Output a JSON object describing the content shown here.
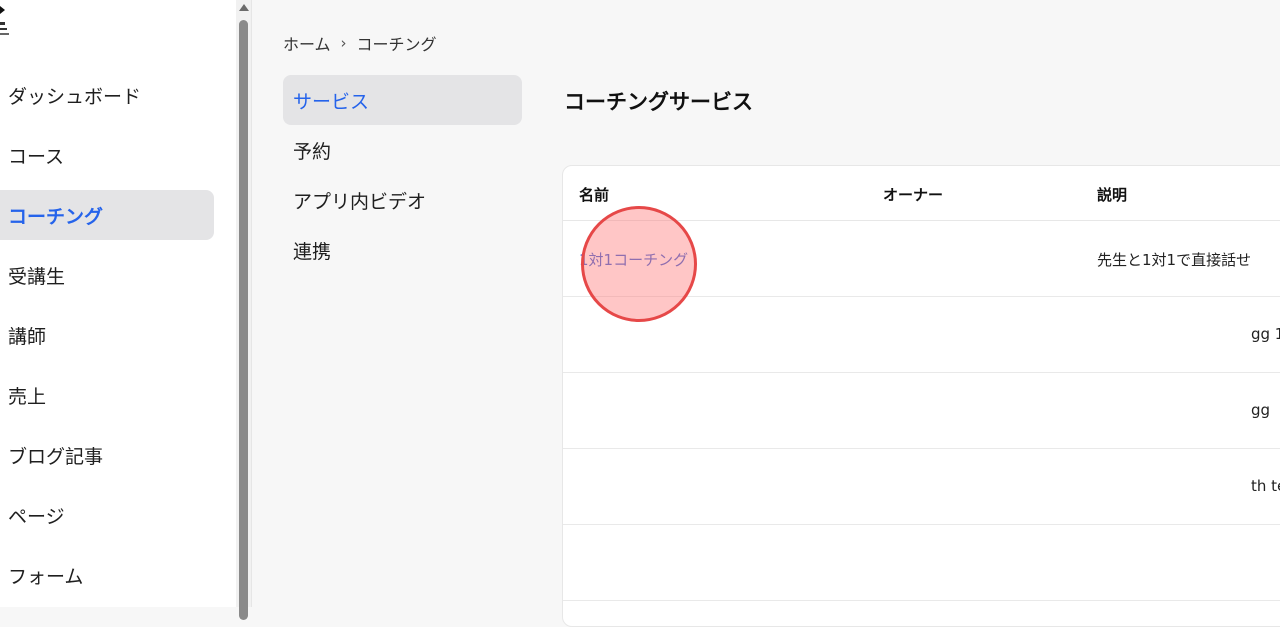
{
  "sidebar": {
    "logo_icon": "brand-logo-icon",
    "items": [
      {
        "label": "ダッシュボード",
        "active": false
      },
      {
        "label": "コース",
        "active": false
      },
      {
        "label": "コーチング",
        "active": true
      },
      {
        "label": "受講生",
        "active": false
      },
      {
        "label": "講師",
        "active": false
      },
      {
        "label": "売上",
        "active": false
      },
      {
        "label": "ブログ記事",
        "active": false
      },
      {
        "label": "ページ",
        "active": false
      },
      {
        "label": "フォーム",
        "active": false
      }
    ]
  },
  "breadcrumb": {
    "home": "ホーム",
    "separator": "›",
    "current": "コーチング"
  },
  "subnav": {
    "items": [
      {
        "label": "サービス",
        "active": true
      },
      {
        "label": "予約",
        "active": false
      },
      {
        "label": "アプリ内ビデオ",
        "active": false
      },
      {
        "label": "連携",
        "active": false
      }
    ]
  },
  "main": {
    "title": "コーチングサービス",
    "table": {
      "columns": [
        "名前",
        "オーナー",
        "説明"
      ],
      "rows": [
        {
          "name": "1対1コーチング",
          "owner": "",
          "description": "先生と1対1で直接話せ"
        },
        {
          "name": "",
          "owner": "",
          "description": "gg 1"
        },
        {
          "name": "",
          "owner": "",
          "description": "gg"
        },
        {
          "name": "",
          "owner": "",
          "description": "th te"
        },
        {
          "name": "",
          "owner": "",
          "description": ""
        }
      ]
    }
  },
  "colors": {
    "accent": "#2563eb",
    "active_bg": "#e4e4e6",
    "link": "#3f68d8",
    "click_indicator": "#e64848"
  }
}
